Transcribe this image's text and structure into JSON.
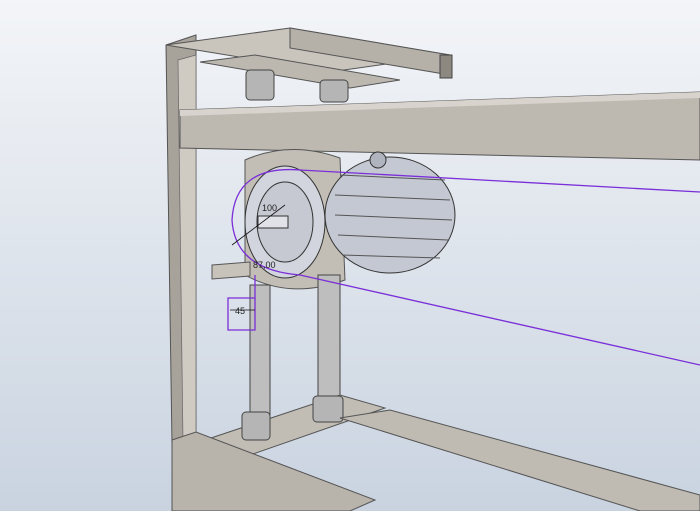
{
  "viewport": {
    "dimensions": {
      "diameter": "100",
      "angle": "87,00",
      "offset": "45"
    },
    "colors": {
      "frame": "#a9a49c",
      "motor": "#c8ccd6",
      "sketch": "#7a2fd8"
    }
  }
}
